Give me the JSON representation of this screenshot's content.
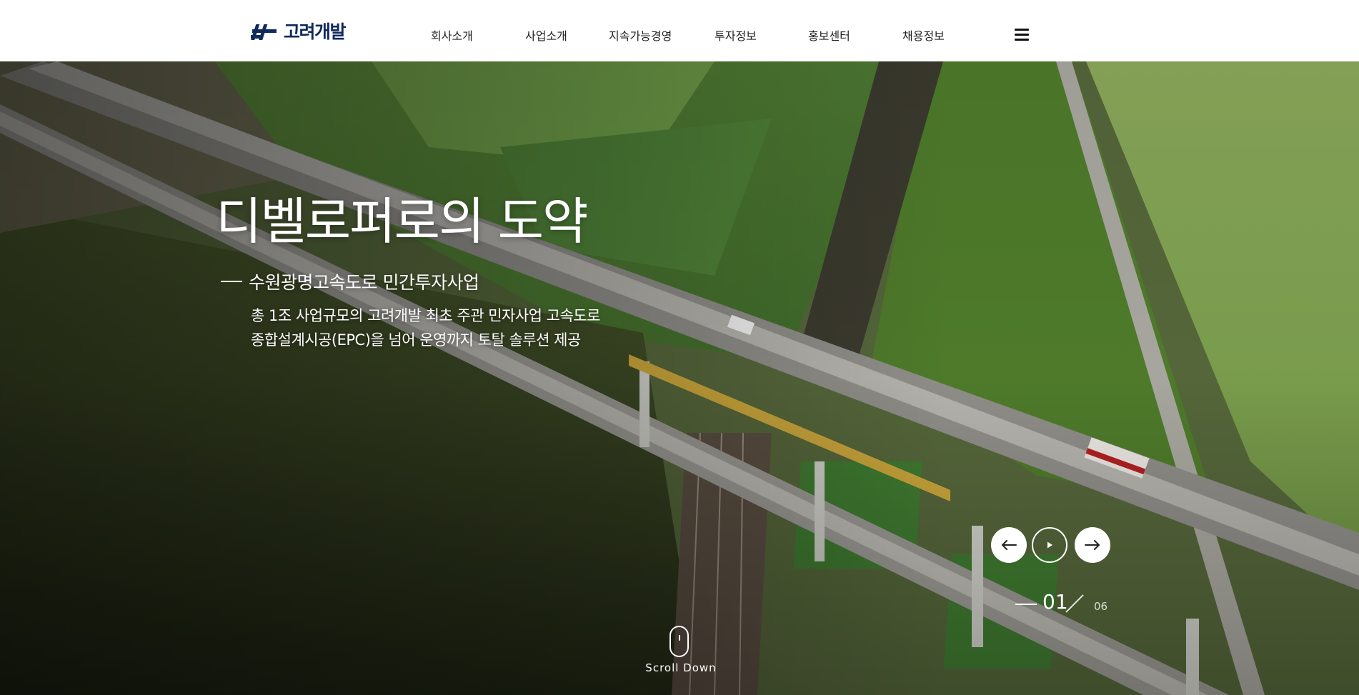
{
  "header": {
    "logo_text": "고려개발",
    "nav": [
      {
        "label": "회사소개"
      },
      {
        "label": "사업소개"
      },
      {
        "label": "지속가능경영"
      },
      {
        "label": "투자정보"
      },
      {
        "label": "홍보센터"
      },
      {
        "label": "채용정보"
      }
    ],
    "menu_icon": "hamburger-icon"
  },
  "hero": {
    "title": "디벨로퍼로의 도약",
    "subtitle": "수원광명고속도로 민간투자사업",
    "description": [
      "총 1조 사업규모의 고려개발 최초 주관 민자사업 고속도로",
      "종합설계시공(EPC)을 넘어 운영까지 토탈 솔루션 제공"
    ],
    "controls": {
      "prev_icon": "arrow-left-icon",
      "play_icon": "play-icon",
      "next_icon": "arrow-right-icon"
    },
    "counter": {
      "current": "01",
      "total": "06"
    },
    "scroll_label": "Scroll Down"
  },
  "colors": {
    "brand": "#102a5c",
    "header_bg": "#ffffff",
    "hero_text": "#ffffff"
  }
}
